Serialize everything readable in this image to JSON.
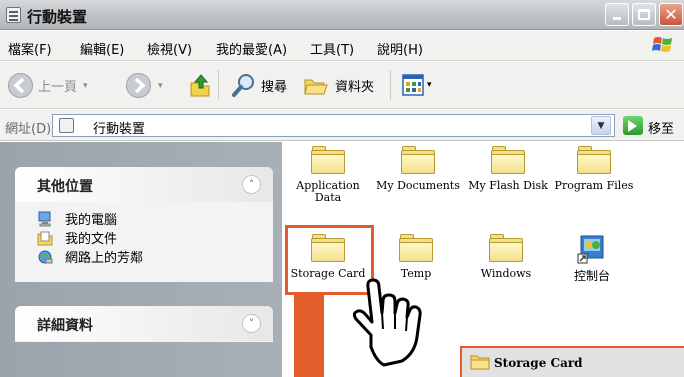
{
  "window": {
    "title": "行動裝置"
  },
  "menubar": {
    "items": [
      "檔案(F)",
      "編輯(E)",
      "檢視(V)",
      "我的最愛(A)",
      "工具(T)",
      "說明(H)"
    ]
  },
  "toolbar": {
    "back_label": "上一頁",
    "search_label": "搜尋",
    "folders_label": "資料夾"
  },
  "address": {
    "label": "網址(D)",
    "value": "行動裝置",
    "go_label": "移至"
  },
  "sidebar": {
    "other_places": {
      "title": "其他位置",
      "collapse_glyph": "˄",
      "items": [
        {
          "label": "我的電腦",
          "icon": "computer-icon"
        },
        {
          "label": "我的文件",
          "icon": "documents-icon"
        },
        {
          "label": "網路上的芳鄰",
          "icon": "network-icon"
        }
      ]
    },
    "details": {
      "title": "詳細資料",
      "collapse_glyph": "˅"
    }
  },
  "content": {
    "items": [
      {
        "label": "Application Data",
        "icon": "folder-icon"
      },
      {
        "label": "My Documents",
        "icon": "folder-icon"
      },
      {
        "label": "My Flash Disk",
        "icon": "folder-icon"
      },
      {
        "label": "Program Files",
        "icon": "folder-icon"
      },
      {
        "label": "Storage Card",
        "icon": "folder-icon"
      },
      {
        "label": "Temp",
        "icon": "folder-icon"
      },
      {
        "label": "Windows",
        "icon": "folder-icon"
      },
      {
        "label": "控制台",
        "icon": "control-panel-icon"
      }
    ],
    "callout_label": "Storage Card"
  },
  "colors": {
    "highlight": "#e35c2c"
  }
}
